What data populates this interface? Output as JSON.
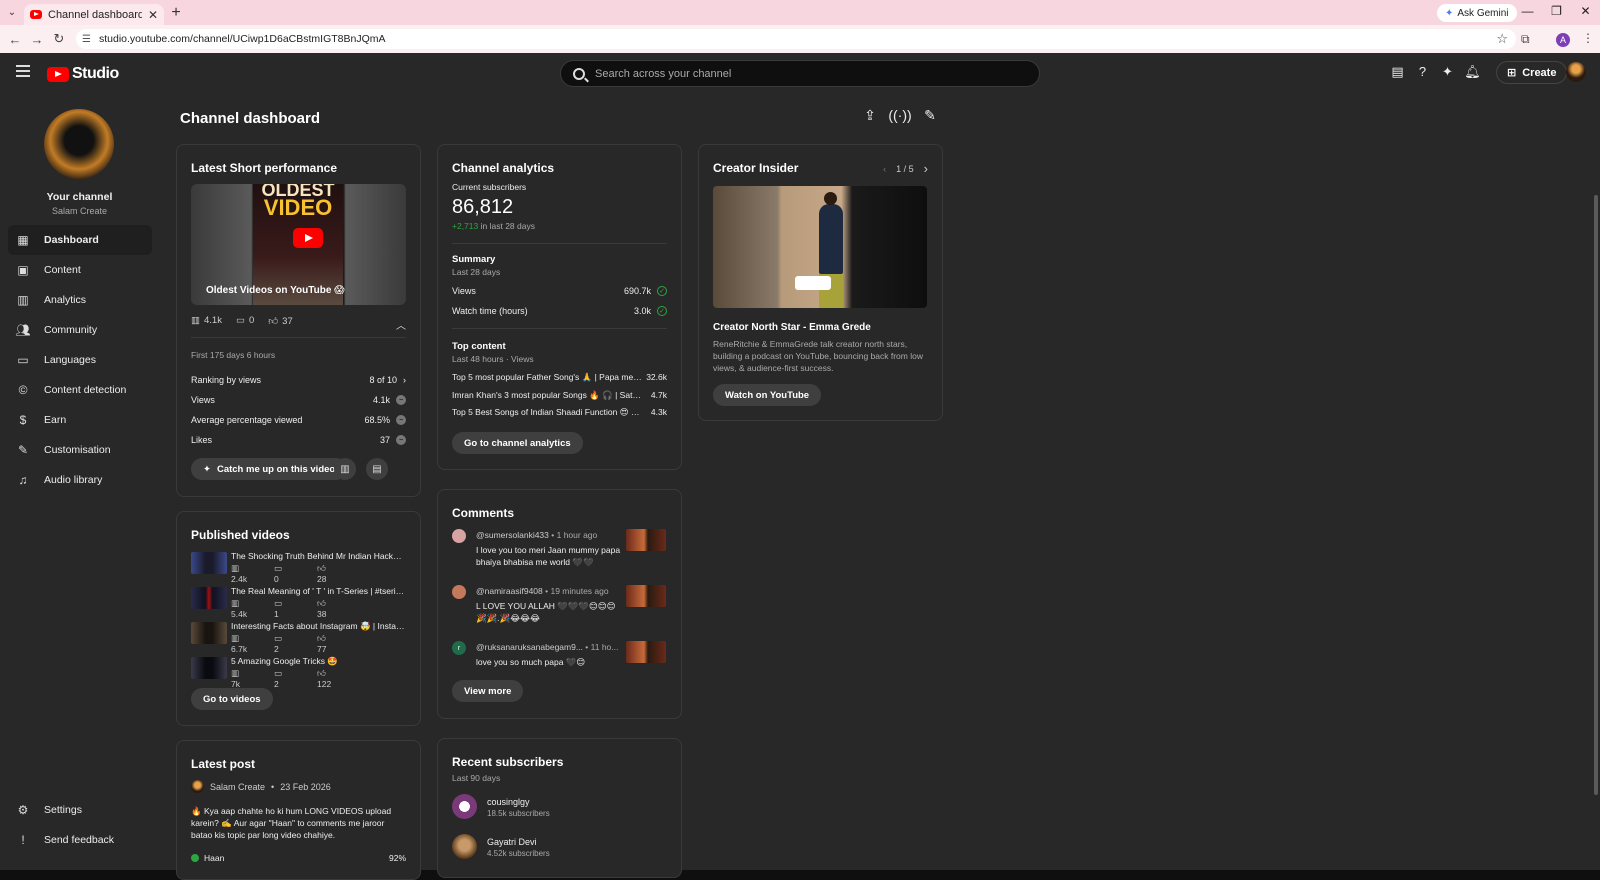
{
  "browser": {
    "tab_title": "Channel dashboard - YouTube",
    "url": "studio.youtube.com/channel/UCiwp1D6aCBstmIGT8BnJQmA",
    "ask_gemini": "Ask Gemini"
  },
  "header": {
    "logo_text": "Studio",
    "search_placeholder": "Search across your channel",
    "create_label": "Create"
  },
  "sidebar": {
    "channel_name": "Your channel",
    "channel_handle": "Salam Create",
    "items": [
      {
        "label": "Dashboard",
        "icon": "dashboard-icon"
      },
      {
        "label": "Content",
        "icon": "content-icon"
      },
      {
        "label": "Analytics",
        "icon": "analytics-icon"
      },
      {
        "label": "Community",
        "icon": "community-icon"
      },
      {
        "label": "Languages",
        "icon": "languages-icon"
      },
      {
        "label": "Content detection",
        "icon": "copyright-icon"
      },
      {
        "label": "Earn",
        "icon": "dollar-icon"
      },
      {
        "label": "Customisation",
        "icon": "magic-wand-icon"
      },
      {
        "label": "Audio library",
        "icon": "audio-library-icon"
      }
    ],
    "bottom": [
      {
        "label": "Settings",
        "icon": "gear-icon"
      },
      {
        "label": "Send feedback",
        "icon": "feedback-icon"
      }
    ]
  },
  "page": {
    "title": "Channel dashboard"
  },
  "latest_short": {
    "title": "Latest Short performance",
    "thumb_line1": "OLDEST",
    "thumb_line2": "VIDEO",
    "caption": "Oldest Videos on YouTube 😱",
    "views": "4.1k",
    "comments": "0",
    "likes": "37",
    "period": "First 175 days 6 hours",
    "rows": [
      {
        "label": "Ranking by views",
        "value": "8 of 10"
      },
      {
        "label": "Views",
        "value": "4.1k"
      },
      {
        "label": "Average percentage viewed",
        "value": "68.5%"
      },
      {
        "label": "Likes",
        "value": "37"
      }
    ],
    "catch_me_up": "Catch me up on this video"
  },
  "published_videos": {
    "title": "Published videos",
    "items": [
      {
        "title": "The Shocking Truth Behind Mr Indian Hacker's ...",
        "views": "2.4k",
        "comments": "0",
        "likes": "28"
      },
      {
        "title": "The Real Meaning of ' T ' in T-Series | #tseries #...",
        "views": "5.4k",
        "comments": "1",
        "likes": "38"
      },
      {
        "title": "Interesting Facts about Instagram 🤯 | Instagr...",
        "views": "6.7k",
        "comments": "2",
        "likes": "77"
      },
      {
        "title": "5 Amazing Google Tricks 🤩",
        "views": "7k",
        "comments": "2",
        "likes": "122"
      }
    ],
    "button": "Go to videos"
  },
  "latest_post": {
    "title": "Latest post",
    "author": "Salam Create",
    "date": "23 Feb 2026",
    "text": "🔥 Kya aap chahte ho ki hum LONG VIDEOS upload karein? ✍️ Aur agar \"Haan\" to comments me jaroor batao kis topic par long video chahiye.",
    "poll_option": "Haan",
    "poll_value": "92%"
  },
  "analytics": {
    "title": "Channel analytics",
    "subs_label": "Current subscribers",
    "subs_value": "86,812",
    "subs_change": "+2,713",
    "subs_change_suffix": "in last 28 days",
    "summary_title": "Summary",
    "summary_period": "Last 28 days",
    "summary_rows": [
      {
        "label": "Views",
        "value": "690.7k"
      },
      {
        "label": "Watch time (hours)",
        "value": "3.0k"
      }
    ],
    "top_title": "Top content",
    "top_period": "Last 48 hours · Views",
    "top_rows": [
      {
        "title": "Top 5 most popular Father Song's 🙏 | Papa mere p...",
        "value": "32.6k"
      },
      {
        "title": "Imran Khan's 3 most popular Songs 🔥 🎧 | Satisfy...",
        "value": "4.7k"
      },
      {
        "title": "Top 5 Best Songs of Indian Shaadi Function 😍 🎧 ...",
        "value": "4.3k"
      }
    ],
    "button": "Go to channel analytics"
  },
  "comments": {
    "title": "Comments",
    "items": [
      {
        "user": "@sumersolanki433",
        "time": "• 1 hour ago",
        "text": "I love you too meri Jaan mummy papa bhaiya bhabisa me world 🖤🖤",
        "avatar_color": "#d9a3a3"
      },
      {
        "user": "@namiraasif9408",
        "time": "• 19 minutes ago",
        "text": "L LOVE YOU ALLAH 🖤🖤🖤😊😊😊🎉🎉.🎉😂😂😂",
        "avatar_color": "#c47a5a"
      },
      {
        "user": "@ruksanaruksanabegam9...",
        "time": "• 11 ho...",
        "text": "love you so much papa 🖤😊",
        "avatar_color": "#1f6b4a",
        "initial": "r"
      }
    ],
    "button": "View more"
  },
  "recent_subscribers": {
    "title": "Recent subscribers",
    "period": "Last 90 days",
    "items": [
      {
        "name": "cousinglgy",
        "count": "18.5k subscribers"
      },
      {
        "name": "Gayatri Devi",
        "count": "4.52k subscribers"
      }
    ]
  },
  "creator_insider": {
    "title": "Creator Insider",
    "pager": "1 / 5",
    "video_title": "Creator North Star - Emma Grede",
    "description": "ReneRitchie & EmmaGrede talk creator north stars, building a podcast on YouTube, bouncing back from low views, & audience-first success.",
    "button": "Watch on YouTube"
  }
}
